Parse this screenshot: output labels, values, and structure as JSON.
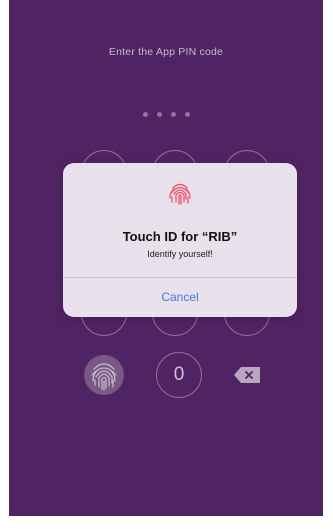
{
  "header": {
    "title": "Enter the App PIN code"
  },
  "pin": {
    "length": 4,
    "entered": 0
  },
  "keypad": {
    "zero_label": "0",
    "fingerprint_icon": "fingerprint-icon",
    "delete_icon": "backspace-icon"
  },
  "dialog": {
    "icon": "fingerprint-icon",
    "title": "Touch ID for “RIB”",
    "subtitle": "Identify yourself!",
    "cancel_label": "Cancel"
  },
  "colors": {
    "background": "#5a2a6e",
    "fingerprint_accent": "#f04f63",
    "cancel_blue": "#3b7be0"
  }
}
